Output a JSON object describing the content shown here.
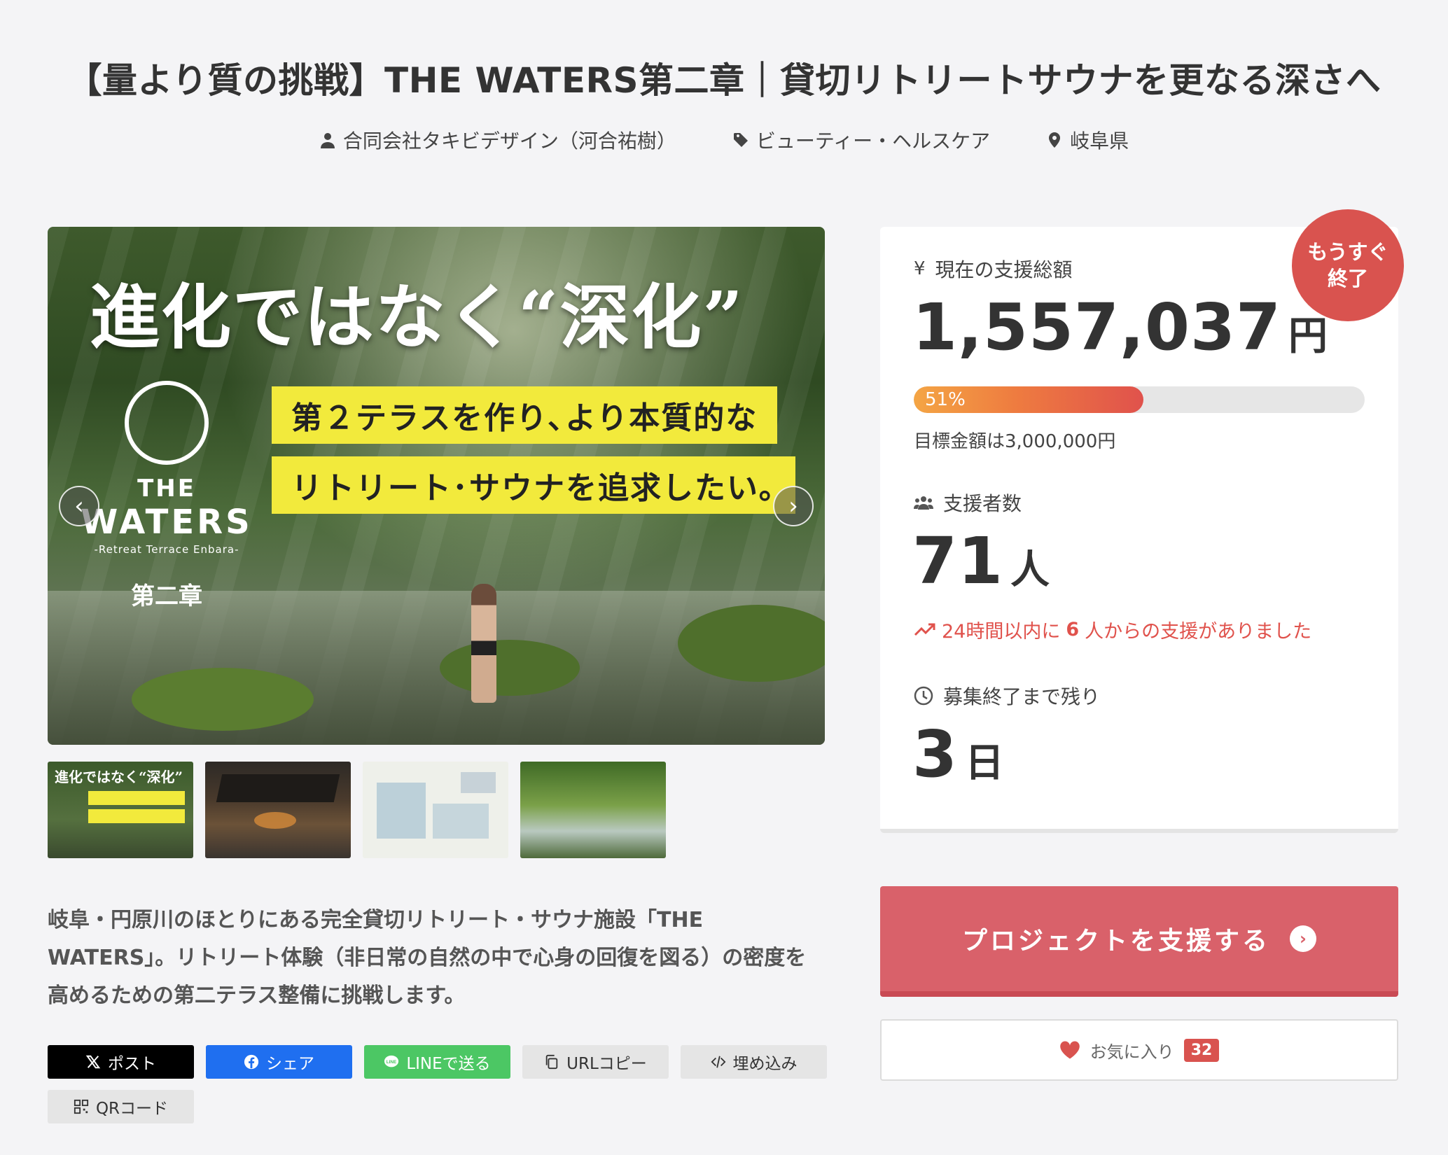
{
  "title": "【量より質の挑戦】THE WATERS第二章｜貸切リトリートサウナを更なる深さへ",
  "meta": {
    "owner": "合同会社タキビデザイン（河合祐樹）",
    "category": "ビューティー・ヘルスケア",
    "location": "岐阜県"
  },
  "hero": {
    "headline": "進化ではなく“深化”",
    "band1": "第２テラスを作り､より本質的な",
    "band2": "リトリート･サウナを追求したい｡",
    "logo_the": "THE",
    "logo_waters": "WATERS",
    "logo_sub": "-Retreat Terrace Enbara-",
    "logo_chapter": "第二章",
    "thumb1_text": "進化ではなく“深化”"
  },
  "description": "岐阜・円原川のほとりにある完全貸切リトリート・サウナ施設「THE WATERS」。リトリート体験（非日常の自然の中で心身の回復を図る）の密度を高めるための第二テラス整備に挑戦します。",
  "share": {
    "x": "ポスト",
    "facebook": "シェア",
    "line": "LINEで送る",
    "url": "URLコピー",
    "embed": "埋め込み",
    "qr": "QRコード"
  },
  "stats": {
    "badge_line1": "もうすぐ",
    "badge_line2": "終了",
    "amount_label": "現在の支援総額",
    "amount": "1,557,037",
    "amount_unit": "円",
    "progress_label": "51%",
    "progress_value": 0.51,
    "goal": "目標金額は3,000,000円",
    "backers_label": "支援者数",
    "backers": "71",
    "backers_unit": "人",
    "recent_prefix": "24時間以内に",
    "recent_count": "6",
    "recent_suffix": "人からの支援がありました",
    "remaining_label": "募集終了まで残り",
    "remaining": "3",
    "remaining_unit": "日"
  },
  "actions": {
    "support": "プロジェクトを支援する",
    "favorite": "お気に入り",
    "favorite_count": "32"
  },
  "colors": {
    "accent": "#d9616a",
    "badge": "#d9534f",
    "trend": "#e0524c",
    "band": "#f2ea3c"
  }
}
